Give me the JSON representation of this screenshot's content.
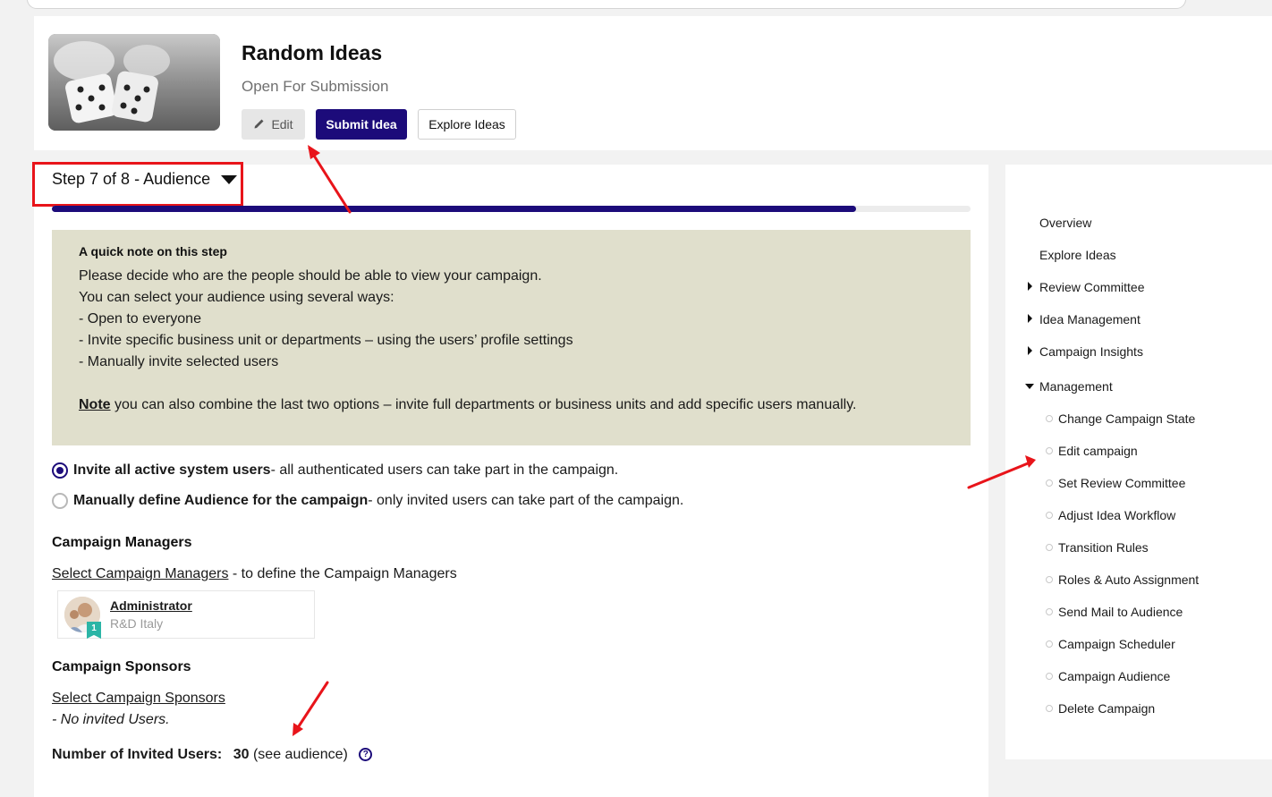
{
  "campaign": {
    "title": "Random Ideas",
    "status": "Open For Submission",
    "buttons": {
      "edit": "Edit",
      "submit": "Submit Idea",
      "explore": "Explore Ideas"
    }
  },
  "wizard": {
    "step_label": "Step 7 of 8 - Audience",
    "progress_fraction": 0.875
  },
  "note": {
    "heading": "A quick note on this step",
    "lines": [
      "Please decide who are the people should be able to view your campaign.",
      "You can select your audience using several ways:",
      "- Open to everyone",
      "- Invite specific business unit or departments – using the users’ profile settings",
      "- Manually invite selected users"
    ],
    "final_emphasis": "Note",
    "final_text": " you can also combine the last two options – invite full departments or business units and add specific users manually."
  },
  "audience_options": [
    {
      "label": "Invite all active system users",
      "desc": " - all authenticated users can take part in the campaign.",
      "selected": true
    },
    {
      "label": "Manually define Audience for the campaign",
      "desc": " - only invited users can take part of the campaign.",
      "selected": false
    }
  ],
  "managers": {
    "heading": "Campaign Managers",
    "link": "Select Campaign Managers",
    "link_suffix": " - to define the Campaign Managers",
    "user": {
      "name": "Administrator",
      "dept": "R&D Italy",
      "badge": "1"
    }
  },
  "sponsors": {
    "heading": "Campaign Sponsors",
    "link": "Select Campaign Sponsors",
    "empty": "- No invited Users."
  },
  "invited": {
    "label": "Number of Invited Users:",
    "count": "30",
    "suffix": "(see audience)",
    "help_icon": "?"
  },
  "side_nav": {
    "items": [
      {
        "label": "Overview",
        "toggle": "none"
      },
      {
        "label": "Explore Ideas",
        "toggle": "none"
      },
      {
        "label": "Review Committee",
        "toggle": "collapsed"
      },
      {
        "label": "Idea Management",
        "toggle": "collapsed"
      },
      {
        "label": "Campaign Insights",
        "toggle": "collapsed"
      },
      {
        "label": "Management",
        "toggle": "expanded"
      }
    ],
    "management_items": [
      "Change Campaign State",
      "Edit campaign",
      "Set Review Committee",
      "Adjust Idea Workflow",
      "Transition Rules",
      "Roles & Auto Assignment",
      "Send Mail to Audience",
      "Campaign Scheduler",
      "Campaign Audience",
      "Delete Campaign"
    ]
  },
  "colors": {
    "primary": "#1c0b7a",
    "annotation": "#e8141a",
    "note_bg": "#e0dfcc"
  }
}
